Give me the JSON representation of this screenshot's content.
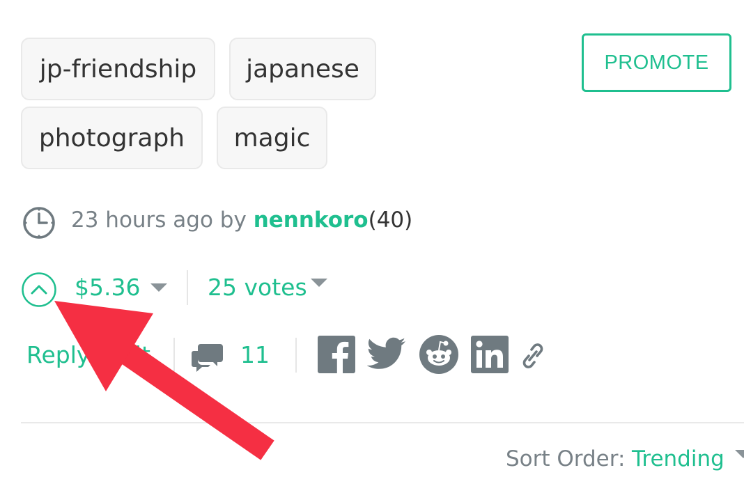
{
  "tags": [
    "jp-friendship",
    "japanese",
    "photograph",
    "magic"
  ],
  "promote_label": "PROMOTE",
  "meta": {
    "time_ago": "23 hours ago by",
    "author": "nennkoro",
    "reputation": "(40)"
  },
  "payout": {
    "amount": "$5.36",
    "votes": "25 votes"
  },
  "actions": {
    "reply_label": "Reply",
    "edit_label": "Edit",
    "comments_count": "11"
  },
  "share": [
    "facebook-icon",
    "twitter-icon",
    "reddit-icon",
    "linkedin-icon",
    "link-icon"
  ],
  "sort": {
    "label": "Sort Order:",
    "value": "Trending"
  },
  "colors": {
    "accent": "#1fbf8f",
    "muted": "#788187",
    "icon": "#6f7a80",
    "annotation_arrow": "#f52f43"
  }
}
